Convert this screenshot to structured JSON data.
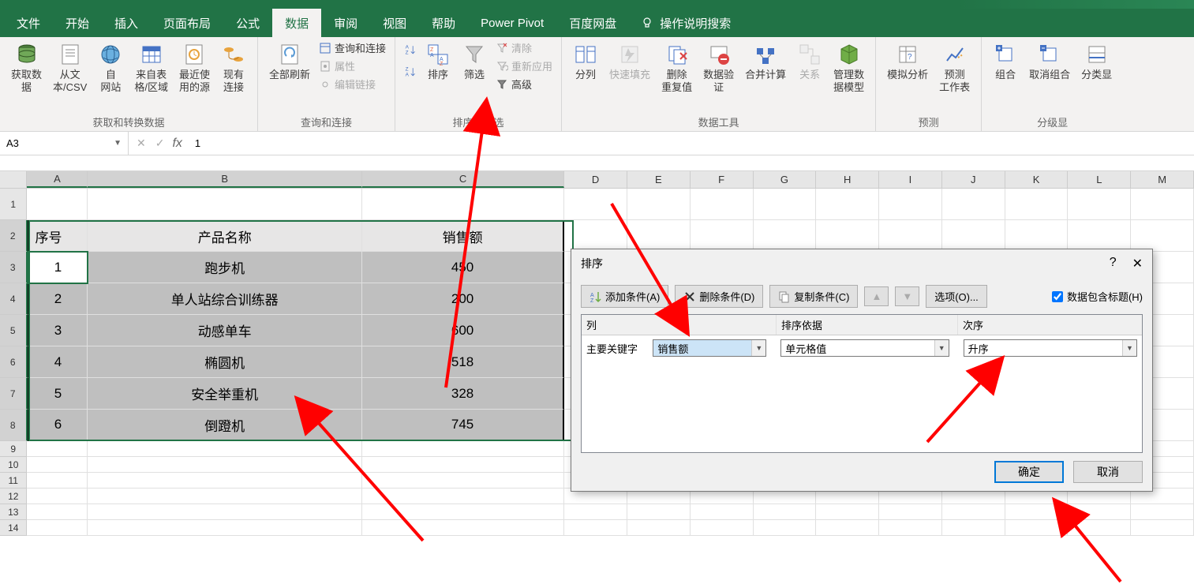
{
  "tabs": {
    "file": "文件",
    "home": "开始",
    "insert": "插入",
    "layout": "页面布局",
    "formula": "公式",
    "data": "数据",
    "review": "审阅",
    "view": "视图",
    "help": "帮助",
    "powerpivot": "Power Pivot",
    "baidu": "百度网盘",
    "search": "操作说明搜索"
  },
  "ribbon": {
    "g1": {
      "getdata": "获取数\n据",
      "fromtext": "从文\n本/CSV",
      "fromweb": "自\n网站",
      "fromtable": "来自表\n格/区域",
      "recent": "最近使\n用的源",
      "conn": "现有\n连接",
      "label": "获取和转换数据"
    },
    "g2": {
      "refresh": "全部刷新",
      "queries": "查询和连接",
      "props": "属性",
      "editlinks": "编辑链接",
      "label": "查询和连接"
    },
    "g3": {
      "sort": "排序",
      "filter": "筛选",
      "clear": "清除",
      "reapply": "重新应用",
      "advanced": "高级",
      "label": "排序和筛选"
    },
    "g4": {
      "split": "分列",
      "flash": "快速填充",
      "dedupe": "删除\n重复值",
      "validate": "数据验\n证",
      "consolidate": "合并计算",
      "relations": "关系",
      "model": "管理数\n据模型",
      "label": "数据工具"
    },
    "g5": {
      "whatif": "模拟分析",
      "forecast": "预测\n工作表",
      "label": "预测"
    },
    "g6": {
      "group": "组合",
      "ungroup": "取消组合",
      "subtotal": "分类显",
      "label": "分级显"
    }
  },
  "namebox": "A3",
  "formula": "1",
  "cols": [
    "A",
    "B",
    "C",
    "D",
    "E",
    "F",
    "G",
    "H",
    "I",
    "J",
    "K",
    "L",
    "M"
  ],
  "rownums": [
    "1",
    "2",
    "3",
    "4",
    "5",
    "6",
    "7",
    "8",
    "9",
    "10",
    "11",
    "12",
    "13",
    "14"
  ],
  "table": {
    "head": {
      "c1": "序号",
      "c2": "产品名称",
      "c3": "销售额"
    },
    "rows": [
      {
        "c1": "1",
        "c2": "跑步机",
        "c3": "450"
      },
      {
        "c1": "2",
        "c2": "单人站综合训练器",
        "c3": "200"
      },
      {
        "c1": "3",
        "c2": "动感单车",
        "c3": "600"
      },
      {
        "c1": "4",
        "c2": "椭圆机",
        "c3": "518"
      },
      {
        "c1": "5",
        "c2": "安全举重机",
        "c3": "328"
      },
      {
        "c1": "6",
        "c2": "倒蹬机",
        "c3": "745"
      }
    ]
  },
  "dialog": {
    "title": "排序",
    "add": "添加条件(A)",
    "del": "删除条件(D)",
    "copy": "复制条件(C)",
    "options": "选项(O)...",
    "header_check": "数据包含标题(H)",
    "col_label": "列",
    "sortby_label": "排序依据",
    "order_label": "次序",
    "mainkey": "主要关键字",
    "field_col": "销售额",
    "field_basis": "单元格值",
    "field_order": "升序",
    "ok": "确定",
    "cancel": "取消"
  }
}
